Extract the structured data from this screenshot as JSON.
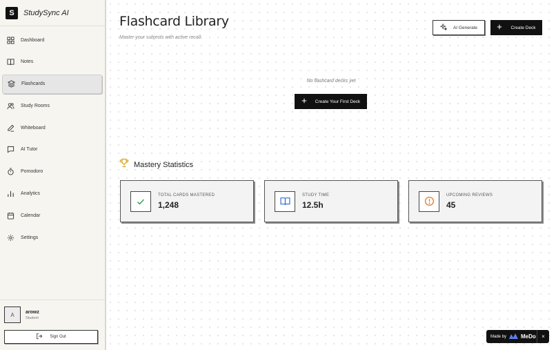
{
  "brand": {
    "logo_letter": "S",
    "name": "StudySync AI"
  },
  "sidebar": {
    "items": [
      {
        "label": "Dashboard",
        "icon": "grid-icon"
      },
      {
        "label": "Notes",
        "icon": "book-open-icon"
      },
      {
        "label": "Flashcards",
        "icon": "layers-icon"
      },
      {
        "label": "Study Rooms",
        "icon": "users-icon"
      },
      {
        "label": "Whiteboard",
        "icon": "pen-icon"
      },
      {
        "label": "AI Tutor",
        "icon": "message-square-icon"
      },
      {
        "label": "Pomodoro",
        "icon": "timer-icon"
      },
      {
        "label": "Analytics",
        "icon": "bar-chart-icon"
      },
      {
        "label": "Calendar",
        "icon": "calendar-icon"
      },
      {
        "label": "Settings",
        "icon": "gear-icon"
      }
    ],
    "active_index": 2
  },
  "user": {
    "avatar_letter": "A",
    "name": "arowz",
    "role": "Student",
    "signout_label": "Sign Out"
  },
  "header": {
    "title": "Flashcard Library",
    "subtitle": "Master your subjects with active recall.",
    "ai_generate_label": "AI Generate",
    "create_deck_label": "Create Deck"
  },
  "empty_state": {
    "message": "No flashcard decks yet",
    "button_label": "Create Your First Deck"
  },
  "stats": {
    "heading": "Mastery Statistics",
    "cards": [
      {
        "label": "Total Cards Mastered",
        "value": "1,248",
        "icon": "check-icon",
        "color": "#2e9e4f"
      },
      {
        "label": "Study Time",
        "value": "12.5h",
        "icon": "book-open-icon",
        "color": "#2f6fd6"
      },
      {
        "label": "Upcoming Reviews",
        "value": "45",
        "icon": "alert-circle-icon",
        "color": "#e07a1f"
      }
    ]
  },
  "badge": {
    "prefix": "Made by",
    "brand": "MeDo",
    "close": "×"
  },
  "colors": {
    "trophy": "#d9a21b"
  }
}
